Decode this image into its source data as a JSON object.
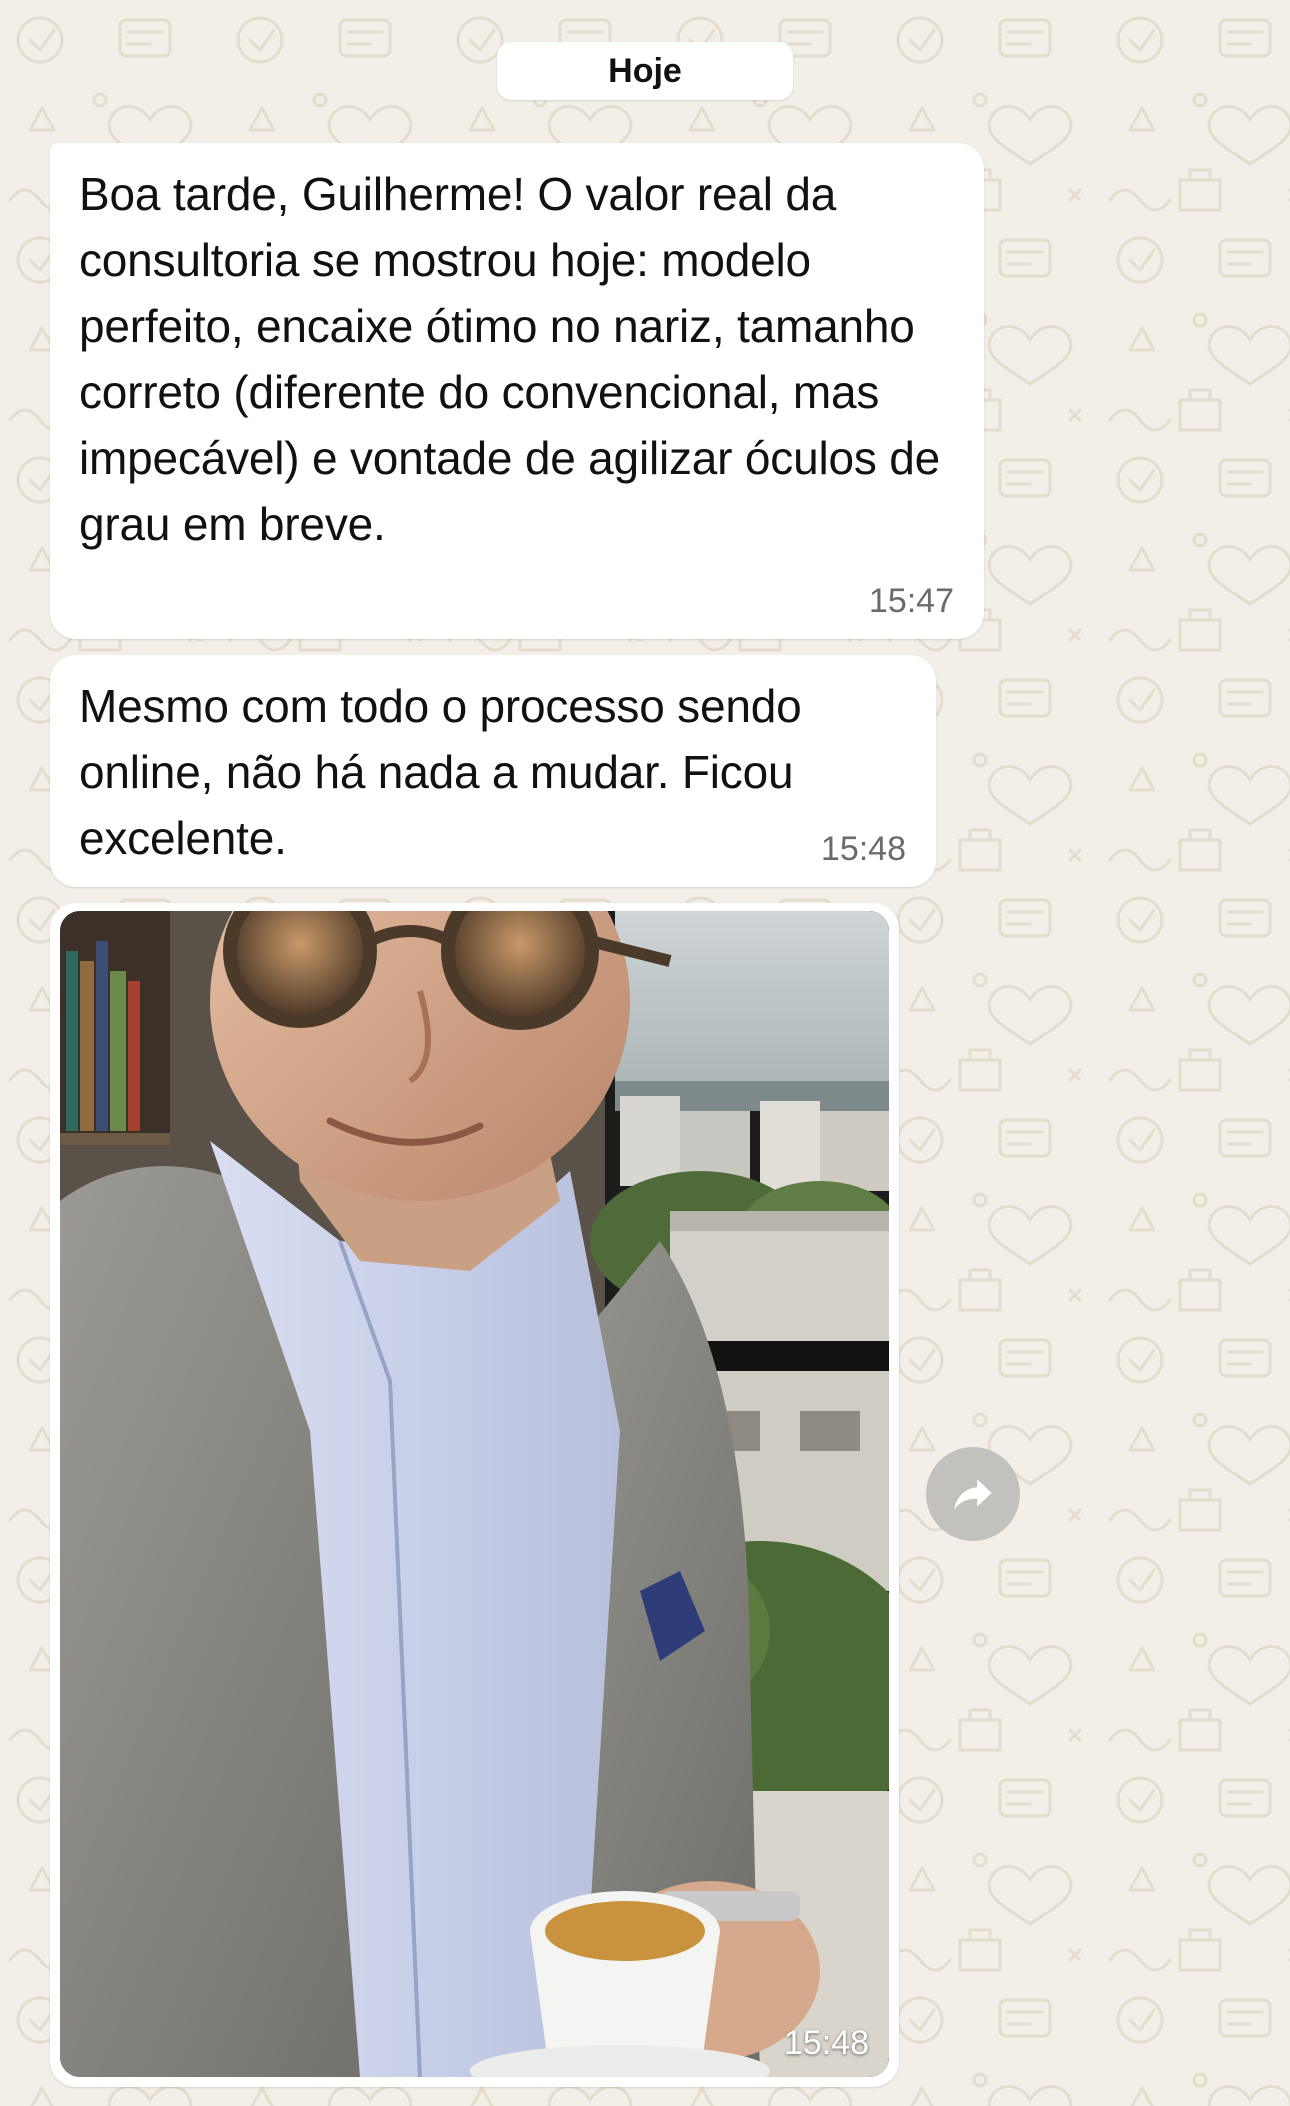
{
  "chat": {
    "date_separator": "Hoje",
    "messages": [
      {
        "text": "Boa tarde, Guilherme! O valor real da consultoria se mostrou hoje: modelo perfeito, encaixe ótimo no nariz, tamanho correto (diferente do convencional, mas impecável) e vontade de agilizar óculos de grau em breve.",
        "time": "15:47"
      },
      {
        "text": "Mesmo com todo o processo sendo online, não há nada a mudar. Ficou excelente.",
        "time": "15:48"
      },
      {
        "type": "image",
        "time": "15:48"
      }
    ]
  },
  "icons": {
    "forward": "forward-icon"
  },
  "colors": {
    "wallpaper": "#f3efe8",
    "bubble": "#ffffff",
    "timestamp": "#6b6b6b",
    "forward_button": "#c3c1bd"
  }
}
